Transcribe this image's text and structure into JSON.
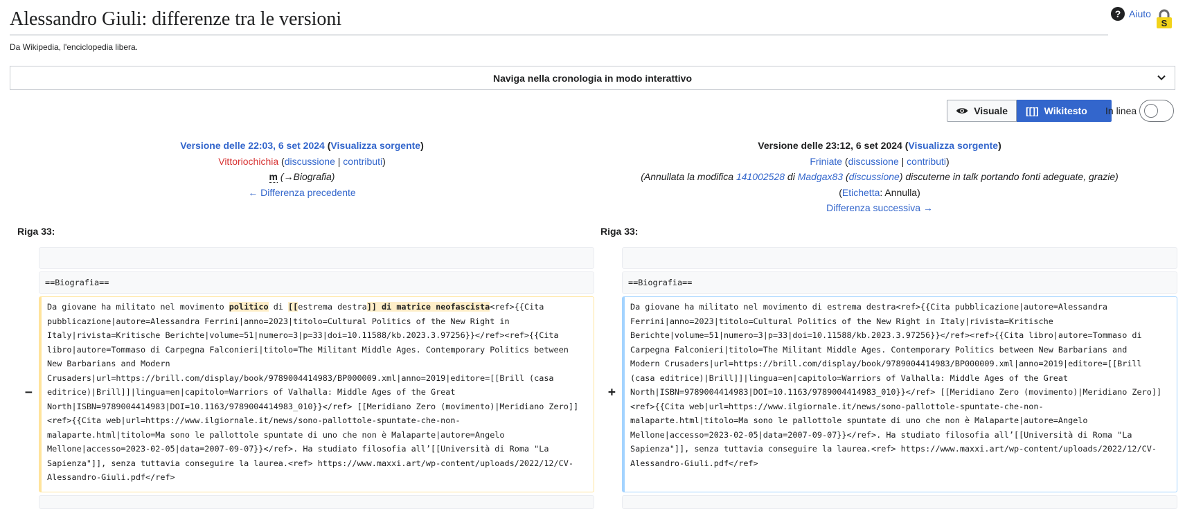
{
  "header": {
    "title": "Alessandro Giuli: differenze tra le versioni",
    "tagline": "Da Wikipedia, l'enciclopedia libera.",
    "help_label": "Aiuto"
  },
  "history_bar": {
    "label": "Naviga nella cronologia in modo interattivo"
  },
  "view_toggle": {
    "visual_label": "Visuale",
    "wikitext_icon": "[[]]",
    "wikitext_label": "Wikitesto",
    "inline_label": "In linea",
    "inline_on": false
  },
  "left_version": {
    "title_prefix": "Versione delle 22:03, 6 set 2024",
    "source_link": "Visualizza sorgente",
    "user": "Vittoriochichia",
    "talk": "discussione",
    "contribs": "contributi",
    "minor_flag": "m",
    "summary": "(→Biografia)",
    "nav": "← Differenza precedente"
  },
  "right_version": {
    "title_prefix": "Versione delle 23:12, 6 set 2024",
    "source_link": "Visualizza sorgente",
    "user": "Friniate",
    "talk": "discussione",
    "contribs": "contributi",
    "summary_pre": "(Annullata la modifica ",
    "summary_revid": "141002528",
    "summary_mid": " di ",
    "summary_user": "Madgax83",
    "summary_talk": "discussione",
    "summary_post": " discuterne in talk portando fonti adeguate, grazie)",
    "tag_label": "Etichetta",
    "tag_value": "Annulla",
    "nav": "Differenza successiva →"
  },
  "diff": {
    "left_line": "Riga 33:",
    "right_line": "Riga 33:",
    "context_line": "==Biografia==",
    "del_marker": "−",
    "add_marker": "+",
    "del_seg1": "Da giovane ha militato nel movimento ",
    "del_hl1": "politico",
    "del_seg2": " di ",
    "del_hl2": "[[",
    "del_seg3": "estrema destra",
    "del_hl3": "]] di matrice neofascista",
    "del_seg4": "<ref>{{Cita\npubblicazione|autore=Alessandra Ferrini|anno=2023|titolo=Cultural Politics of the New Right in\nItaly|rivista=Kritische Berichte|volume=51|numero=3|p=33|doi=10.11588/kb.2023.3.97256}}</ref><ref>{{Cita\nlibro|autore=Tommaso di Carpegna Falconieri|titolo=The Militant Middle Ages. Contemporary Politics between\nNew Barbarians and Modern\nCrusaders|url=https://brill.com/display/book/9789004414983/BP000009.xml|anno=2019|editore=[[Brill (casa\neditrice)|Brill]]|lingua=en|capitolo=Warriors of Valhalla: Middle Ages of the Great\nNorth|ISBN=9789004414983|DOI=10.1163/9789004414983_010}}</ref> [[Meridiano Zero (movimento)|Meridiano Zero]]\n<ref>{{Cita web|url=https://www.ilgiornale.it/news/sono-pallottole-spuntate-che-non-\nmalaparte.html|titolo=Ma sono le pallottole spuntate di uno che non è Malaparte|autore=Angelo\nMellone|accesso=2023-02-05|data=2007-09-07}}</ref>. Ha studiato filosofia all’[[Università di Roma \"La\nSapienza\"]], senza tuttavia conseguire la laurea.<ref> https://www.maxxi.art/wp-content/uploads/2022/12/CV-\nAlessandro-Giuli.pdf</ref>",
    "add_text": "Da giovane ha militato nel movimento di estrema destra<ref>{{Cita pubblicazione|autore=Alessandra\nFerrini|anno=2023|titolo=Cultural Politics of the New Right in Italy|rivista=Kritische\nBerichte|volume=51|numero=3|p=33|doi=10.11588/kb.2023.3.97256}}</ref><ref>{{Cita libro|autore=Tommaso di\nCarpegna Falconieri|titolo=The Militant Middle Ages. Contemporary Politics between New Barbarians and\nModern Crusaders|url=https://brill.com/display/book/9789004414983/BP000009.xml|anno=2019|editore=[[Brill\n(casa editrice)|Brill]]|lingua=en|capitolo=Warriors of Valhalla: Middle Ages of the Great\nNorth|ISBN=9789004414983|DOI=10.1163/9789004414983_010}}</ref> [[Meridiano Zero (movimento)|Meridiano Zero]]\n<ref>{{Cita web|url=https://www.ilgiornale.it/news/sono-pallottole-spuntate-che-non-\nmalaparte.html|titolo=Ma sono le pallottole spuntate di uno che non è Malaparte|autore=Angelo\nMellone|accesso=2023-02-05|data=2007-09-07}}</ref>. Ha studiato filosofia all’[[Università di Roma \"La\nSapienza\"]], senza tuttavia conseguire la laurea.<ref> https://www.maxxi.art/wp-content/uploads/2022/12/CV-\nAlessandro-Giuli.pdf</ref>"
  },
  "colors": {
    "link": "#3366cc",
    "redlink": "#d73333",
    "deleted_border": "#ffe49c",
    "added_border": "#a3d3ff",
    "deleted_highlight": "#feeec8"
  }
}
